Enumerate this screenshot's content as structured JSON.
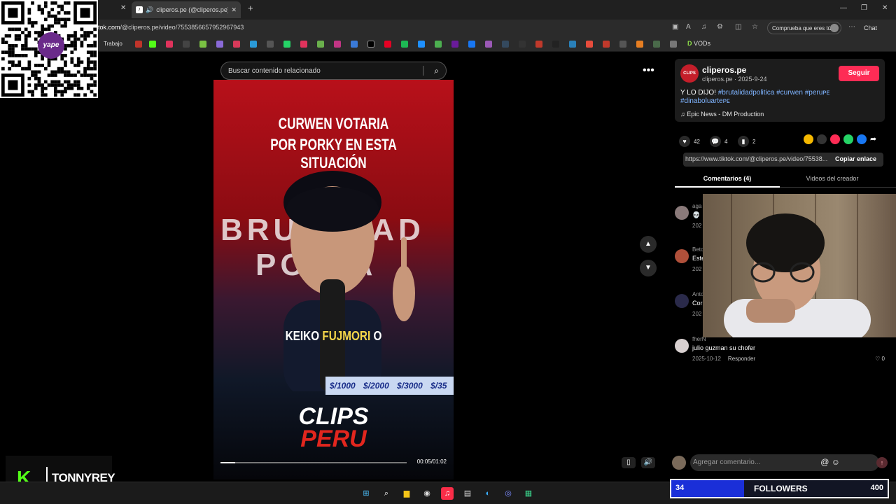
{
  "browser": {
    "active_tab_title": "cliperos.pe (@cliperos.pe) | Ti",
    "url_prefix": "tok.com",
    "url_path": "/@cliperos.pe/video/7553856657952967943",
    "profile_prompt": "Comprueba que eres tú",
    "chat_label": "Chat",
    "bookmark_folder": "Trabajo",
    "bookmark_vods": "VODs"
  },
  "overlays": {
    "qr_badge_text": "yape",
    "streamer_name": "TONNYREY"
  },
  "search": {
    "placeholder": "Buscar contenido relacionado"
  },
  "video": {
    "headline_line1": "CURWEN VOTARIA",
    "headline_line2": "POR PORKY EN ESTA SITUACIÓN",
    "bg_text_1": "BRUT",
    "bg_text_2": "AD",
    "bg_text_3": "PO",
    "bg_text_4": "A",
    "caption_pre": "KEIKO ",
    "caption_highlight": "FUJMORI",
    "caption_post": " O",
    "ticker": "$/1000 $/2000 $/3000 $/35",
    "logo_top": "CLIPS",
    "logo_bottom": "PERU",
    "time": "00:05/01:02",
    "progress_fraction": 0.08
  },
  "post": {
    "channel_name": "cliperos.pe",
    "channel_avatar_text": "CLIPS",
    "channel_meta": "cliperos.pe · 2025-9-24",
    "follow_label": "Seguir",
    "desc_plain": "Y LO DIJO! ",
    "desc_tags_line1": "#brutalidadpolitica #curwen #peruᴘᴇ",
    "desc_tags_line2": "#dinaboluarteᴘᴇ",
    "music": "Epic News - DM Production",
    "likes": "42",
    "comments_count": "4",
    "saves": "2",
    "link": "https://www.tiktok.com/@cliperos.pe/video/75538...",
    "copy_link_label": "Copiar enlace",
    "tab_comments": "Comentarios (4)",
    "tab_creator": "Videos del creador"
  },
  "comments": [
    {
      "user": "aga",
      "text": "💀",
      "meta": "202"
    },
    {
      "user": "Beto",
      "text": "Este",
      "meta": "202"
    },
    {
      "user": "Anto",
      "text": "Cor",
      "meta": "202"
    },
    {
      "user": "fherN",
      "text": "julio guzman su chofer",
      "meta": "2025-10-12",
      "reply": "Responder",
      "likes": "0"
    }
  ],
  "comment_input": {
    "placeholder": "Agregar comentario..."
  },
  "followers_goal": {
    "label": "FOLLOWERS",
    "current": "34",
    "goal": "400",
    "fraction": 0.085
  },
  "colors": {
    "accent_follow": "#fe2c55",
    "hashtag": "#7fb4ff",
    "followers_bar": "#1a2fd8",
    "kick_green": "#53fc18"
  }
}
